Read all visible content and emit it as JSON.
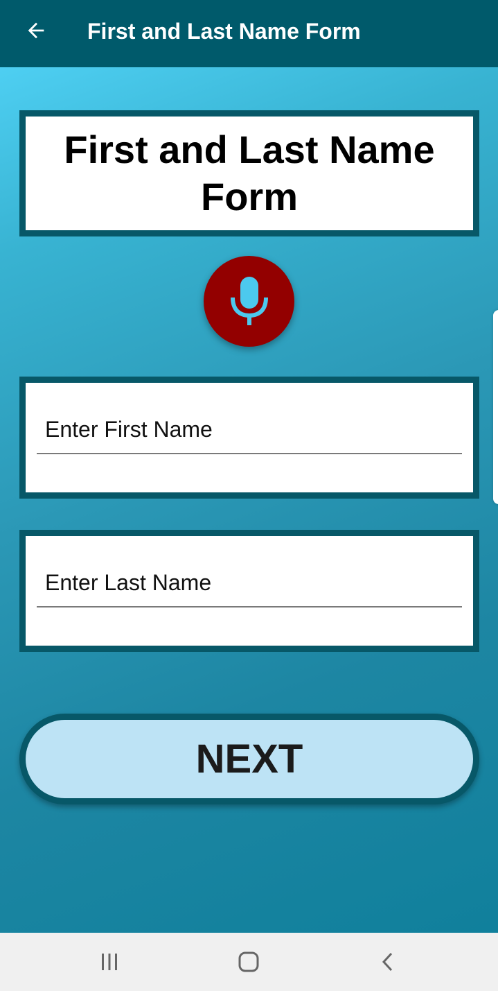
{
  "app_bar": {
    "title": "First and Last Name Form",
    "back_icon": "arrow-left-icon"
  },
  "form": {
    "heading": "First and Last Name Form",
    "mic_icon": "microphone-icon",
    "first_name": {
      "placeholder": "Enter First Name",
      "value": ""
    },
    "last_name": {
      "placeholder": "Enter Last Name",
      "value": ""
    },
    "next_label": "NEXT"
  },
  "nav_bar": {
    "recents_icon": "recents-icon",
    "home_icon": "home-icon",
    "back_icon": "back-chevron-icon"
  },
  "colors": {
    "app_bar": "#005a6b",
    "border": "#075868",
    "mic_button": "#930000",
    "mic_glyph": "#4cc9ee",
    "next_button": "#bde3f5",
    "background_top": "#4ecff2",
    "background_bottom": "#10809c"
  }
}
